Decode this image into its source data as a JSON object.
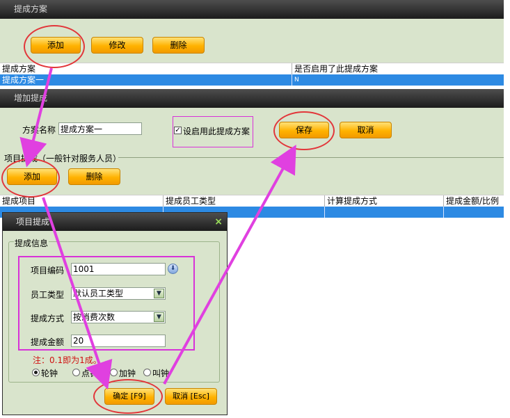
{
  "top_panel": {
    "title": "提成方案",
    "buttons": {
      "add": "添加",
      "edit": "修改",
      "delete": "删除"
    },
    "grid": {
      "columns": [
        "提成方案",
        "是否启用了此提成方案"
      ],
      "rows": [
        {
          "name": "提成方案一",
          "enabled": "N"
        }
      ]
    }
  },
  "add_panel": {
    "title": "增加提成",
    "scheme_name_label": "方案名称",
    "scheme_name_value": "提成方案一",
    "enable_label": "设启用此提成方案",
    "enable_checked": "✓",
    "save": "保存",
    "cancel": "取消",
    "group_label": "项目提成（一般针对服务人员）",
    "buttons": {
      "add": "添加",
      "delete": "删除"
    },
    "grid": {
      "columns": [
        "提成项目",
        "提成员工类型",
        "计算提成方式",
        "提成金额/比例"
      ]
    }
  },
  "dialog": {
    "title": "项目提成",
    "close": "×",
    "group_label": "提成信息",
    "fields": {
      "item_code_label": "项目编码",
      "item_code_value": "1001",
      "staff_type_label": "员工类型",
      "staff_type_value": "默认员工类型",
      "method_label": "提成方式",
      "method_value": "按消费次数",
      "amount_label": "提成金额",
      "amount_value": "20"
    },
    "note": "注：0.1即为1成。",
    "radios": [
      "轮钟",
      "点钟",
      "加钟",
      "叫钟"
    ],
    "radio_selected_index": 0,
    "ok": "确定 [F9]",
    "cancel": "取消 [Esc]"
  },
  "colors": {
    "panel_bg": "#d9e4cc",
    "annotation_red": "#e2363a",
    "annotation_magenta": "#d832d8",
    "selection_blue": "#2d8ae3"
  }
}
